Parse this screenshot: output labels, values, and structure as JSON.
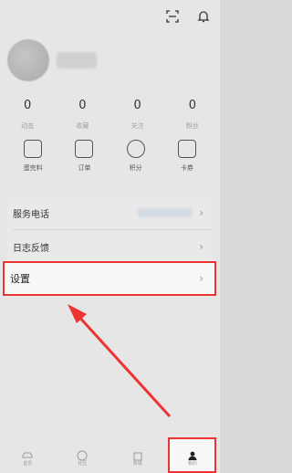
{
  "topbar": {
    "scan_icon": "scan-icon",
    "bell_icon": "bell-icon"
  },
  "stats": [
    {
      "value": "0",
      "label": "动态"
    },
    {
      "value": "0",
      "label": "收藏"
    },
    {
      "value": "0",
      "label": "关注"
    },
    {
      "value": "0",
      "label": "粉丝"
    }
  ],
  "shortcuts": [
    {
      "label": "蛋完料",
      "icon": "bag-icon"
    },
    {
      "label": "订单",
      "icon": "document-icon"
    },
    {
      "label": "积分",
      "icon": "coin-icon"
    },
    {
      "label": "卡券",
      "icon": "ticket-icon"
    }
  ],
  "menu": {
    "service_phone": "服务电话",
    "log_feedback": "日志反馈"
  },
  "settings": {
    "label": "设置"
  },
  "tabs": [
    {
      "label": "首页",
      "icon": "car-icon"
    },
    {
      "label": "社区",
      "icon": "compass-icon"
    },
    {
      "label": "商城",
      "icon": "bag-icon"
    },
    {
      "label": "我的",
      "icon": "person-icon"
    }
  ],
  "accent": "#e33333"
}
